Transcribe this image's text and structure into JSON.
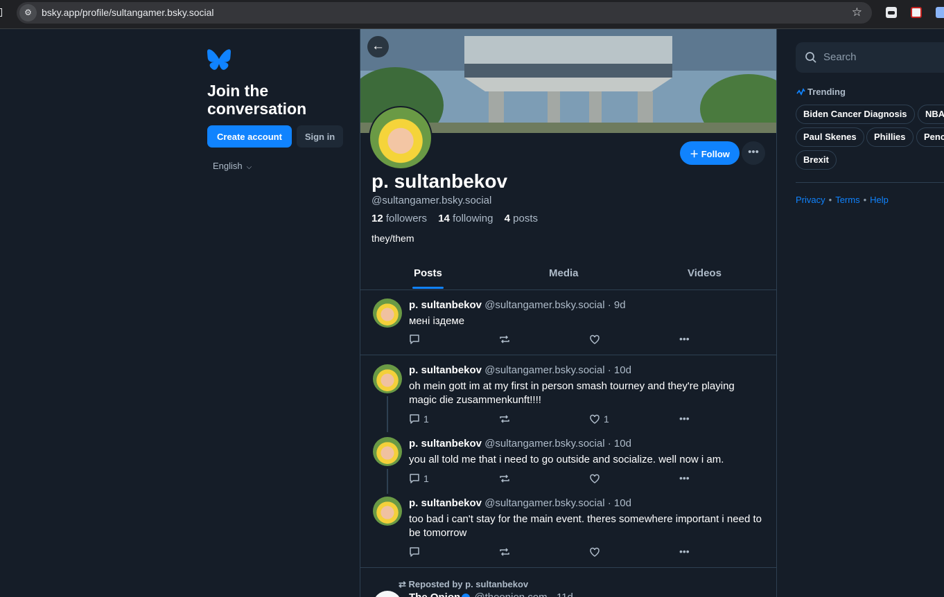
{
  "browser": {
    "url": "bsky.app/profile/sultangamer.bsky.social"
  },
  "left": {
    "heading": "Join the conversation",
    "create_account": "Create account",
    "sign_in": "Sign in",
    "language": "English"
  },
  "profile": {
    "name": "p. sultanbekov",
    "handle": "@sultangamer.bsky.social",
    "followers_count": "12",
    "followers_label": "followers",
    "following_count": "14",
    "following_label": "following",
    "posts_count": "4",
    "posts_label": "posts",
    "bio": "they/them",
    "follow_label": "Follow"
  },
  "tabs": [
    "Posts",
    "Media",
    "Videos"
  ],
  "posts": [
    {
      "author": "p. sultanbekov",
      "handle": "@sultangamer.bsky.social",
      "time": "· 9d",
      "text": "мені іздеме",
      "replies": "",
      "likes": ""
    },
    {
      "author": "p. sultanbekov",
      "handle": "@sultangamer.bsky.social",
      "time": "· 10d",
      "text": "oh mein gott im at my first in person smash tourney and they're playing magic die zusammenkunft!!!!",
      "replies": "1",
      "likes": "1"
    },
    {
      "author": "p. sultanbekov",
      "handle": "@sultangamer.bsky.social",
      "time": "· 10d",
      "text": "you all told me that i need to go outside and socialize. well now i am.",
      "replies": "1",
      "likes": ""
    },
    {
      "author": "p. sultanbekov",
      "handle": "@sultangamer.bsky.social",
      "time": "· 10d",
      "text": "too bad i can't stay for the main event. theres somewhere important i need to be tomorrow",
      "replies": "",
      "likes": ""
    }
  ],
  "repost": {
    "label": "Reposted by p. sultanbekov",
    "author": "The Onion",
    "handle": "@theonion.com",
    "time": "· 11d"
  },
  "right": {
    "search_placeholder": "Search",
    "trending_title": "Trending",
    "chips": [
      "Biden Cancer Diagnosis",
      "NBA",
      "Paul Skenes",
      "Phillies",
      "Penc",
      "Brexit"
    ],
    "links": [
      "Privacy",
      "Terms",
      "Help"
    ]
  },
  "colors": {
    "background": "#151d28",
    "accent": "#1083fe",
    "muted_text": "#aebbc9",
    "border": "#2e4052"
  },
  "icons": [
    "site-settings-icon",
    "star-icon",
    "butterfly-logo-icon",
    "back-arrow-icon",
    "plus-icon",
    "more-icon",
    "reply-icon",
    "repost-icon",
    "like-icon",
    "search-icon",
    "trending-icon",
    "verified-icon"
  ]
}
